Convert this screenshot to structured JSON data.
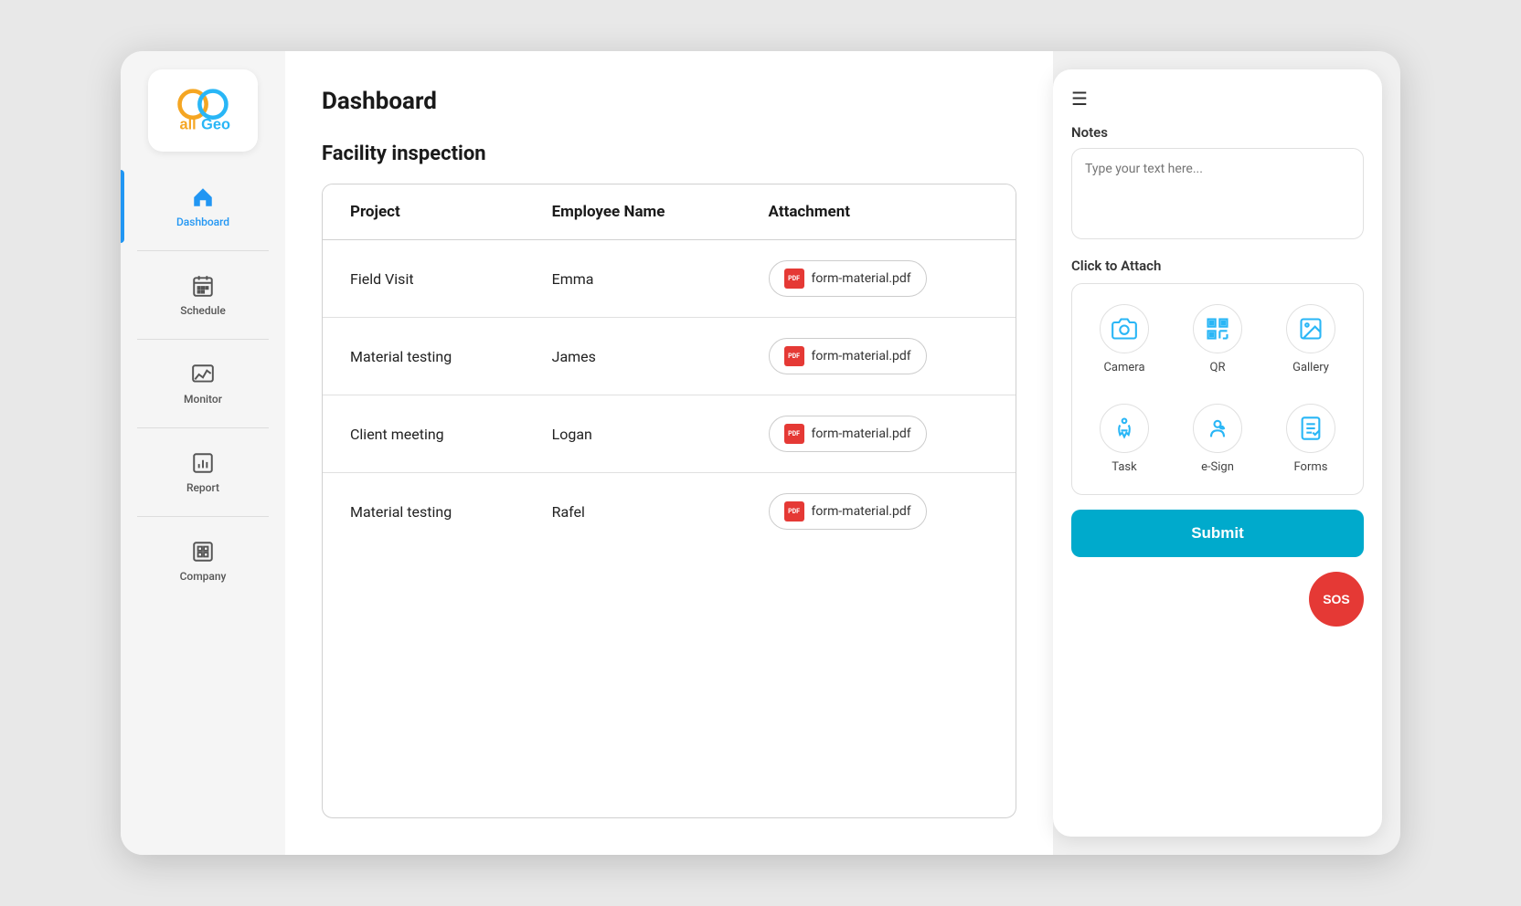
{
  "app": {
    "name": "allGeo"
  },
  "header": {
    "title": "Dashboard"
  },
  "sidebar": {
    "items": [
      {
        "id": "dashboard",
        "label": "Dashboard",
        "active": true
      },
      {
        "id": "schedule",
        "label": "Schedule",
        "active": false
      },
      {
        "id": "monitor",
        "label": "Monitor",
        "active": false
      },
      {
        "id": "report",
        "label": "Report",
        "active": false
      },
      {
        "id": "company",
        "label": "Company",
        "active": false
      }
    ]
  },
  "main": {
    "section_title": "Facility inspection",
    "table": {
      "headers": [
        "Project",
        "Employee Name",
        "Attachment"
      ],
      "rows": [
        {
          "project": "Field Visit",
          "employee": "Emma",
          "attachment": "form-material.pdf"
        },
        {
          "project": "Material testing",
          "employee": "James",
          "attachment": "form-material.pdf"
        },
        {
          "project": "Client meeting",
          "employee": "Logan",
          "attachment": "form-material.pdf"
        },
        {
          "project": "Material testing",
          "employee": "Rafel",
          "attachment": "form-material.pdf"
        }
      ]
    }
  },
  "right_panel": {
    "notes_label": "Notes",
    "notes_placeholder": "Type your text here...",
    "attach_label": "Click to Attach",
    "attach_items": [
      {
        "id": "camera",
        "label": "Camera"
      },
      {
        "id": "qr",
        "label": "QR"
      },
      {
        "id": "gallery",
        "label": "Gallery"
      },
      {
        "id": "task",
        "label": "Task"
      },
      {
        "id": "esign",
        "label": "e-Sign"
      },
      {
        "id": "forms",
        "label": "Forms"
      }
    ],
    "submit_label": "Submit",
    "sos_label": "SOS"
  }
}
